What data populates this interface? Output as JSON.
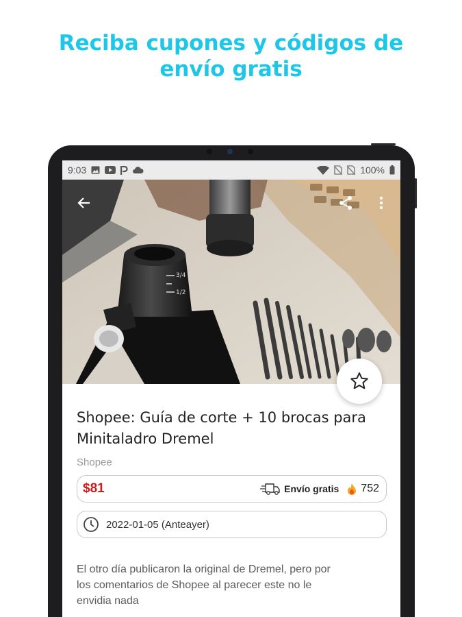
{
  "headline": {
    "line1": "Reciba cupones y códigos de",
    "line2": "envío gratis"
  },
  "colors": {
    "accent": "#1ec6e8",
    "price": "#d11a1a",
    "fire": "#f5a623"
  },
  "status_bar": {
    "time": "9:03",
    "left_icons": [
      "image-icon",
      "youtube-icon",
      "parking-icon",
      "cloud-icon"
    ],
    "right_icons": [
      "wifi-icon",
      "no-sim-icon",
      "no-sim-icon",
      "battery-icon"
    ],
    "battery": "100%"
  },
  "hero": {
    "image": "product-photo-dremel-cutting-guide-and-drill-bits",
    "back_icon": "arrow-back-icon",
    "share_icon": "share-icon",
    "more_icon": "more-vert-icon",
    "favorite_icon": "star-outline-icon"
  },
  "deal": {
    "title_line1": "Shopee: Guía de corte + 10 brocas para",
    "title_line2": "Minitaladro Dremel",
    "store": "Shopee",
    "price": "$81",
    "shipping_icon": "truck-icon",
    "shipping_label": "Envío gratis",
    "heat_icon": "fire-icon",
    "heat_count": "752",
    "date_icon": "clock-icon",
    "date": "2022-01-05 (Anteayer)",
    "description_line1": "El otro día publicaron la original de Dremel, pero por",
    "description_line2": "los comentarios de Shopee al parecer este no le",
    "description_line3": "envidia nada"
  }
}
